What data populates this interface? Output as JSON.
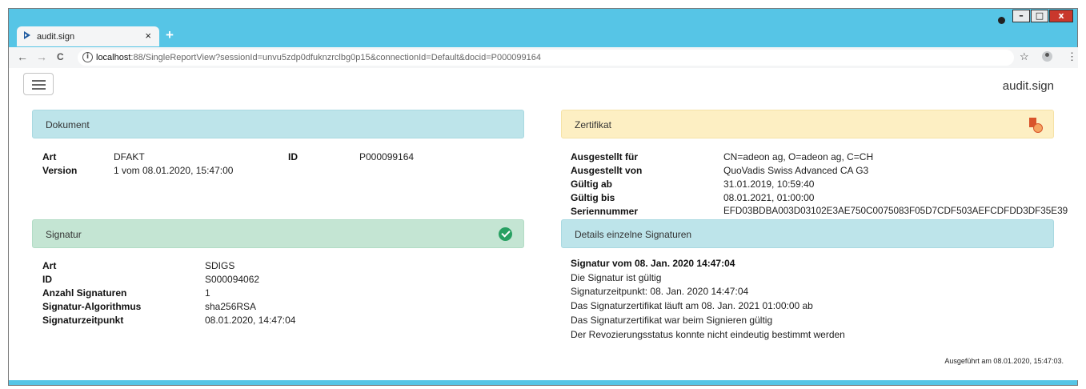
{
  "browser": {
    "tab_title": "audit.sign",
    "tab_close": "×",
    "new_tab": "+",
    "url_host": "localhost",
    "url_rest": ":88/SingleReportView?sessionId=unvu5zdp0dfuknzrclbg0p15&connectionId=Default&docid=P000099164",
    "back_glyph": "←",
    "forward_glyph": "→",
    "reload_glyph": "C",
    "star_glyph": "☆",
    "menu_glyph": "⋮",
    "win_min": "–",
    "win_max": "□",
    "win_close": "x"
  },
  "header": {
    "brand": "audit.sign"
  },
  "dokument": {
    "title": "Dokument",
    "art_label": "Art",
    "art_value": "DFAKT",
    "version_label": "Version",
    "version_value": "1 vom 08.01.2020, 15:47:00",
    "id_label": "ID",
    "id_value": "P000099164"
  },
  "signatur": {
    "title": "Signatur",
    "status_icon": "check-circle",
    "status_color": "#28a062",
    "rows": [
      {
        "label": "Art",
        "value": "SDIGS"
      },
      {
        "label": "ID",
        "value": "S000094062"
      },
      {
        "label": "Anzahl Signaturen",
        "value": "1"
      },
      {
        "label": "Signatur-Algorithmus",
        "value": "sha256RSA"
      },
      {
        "label": "Signaturzeitpunkt",
        "value": "08.01.2020, 14:47:04"
      }
    ]
  },
  "zertifikat": {
    "title": "Zertifikat",
    "rows": [
      {
        "label": "Ausgestellt für",
        "value": "CN=adeon ag, O=adeon ag, C=CH"
      },
      {
        "label": "Ausgestellt von",
        "value": "QuoVadis Swiss Advanced CA G3"
      },
      {
        "label": "Gültig ab",
        "value": "31.01.2019, 10:59:40"
      },
      {
        "label": "Gültig bis",
        "value": "08.01.2021, 01:00:00"
      },
      {
        "label": "Seriennummer",
        "value": "EFD03BDBA003D03102E3AE750C0075083F05D7CDF503AEFCDFDD3DF35E39"
      }
    ]
  },
  "details": {
    "title": "Details einzelne Signaturen",
    "heading": "Signatur vom 08. Jan. 2020 14:47:04",
    "lines": [
      "Die Signatur ist gültig",
      "Signaturzeitpunkt: 08. Jan. 2020 14:47:04",
      "Das Signaturzertifikat läuft am 08. Jan. 2021 01:00:00 ab",
      "Das Signaturzertifikat war beim Signieren gültig",
      "Der Revozierungsstatus konnte nicht eindeutig bestimmt werden"
    ]
  },
  "footer": {
    "text": "Ausgeführt am 08.01.2020, 15:47:03."
  }
}
